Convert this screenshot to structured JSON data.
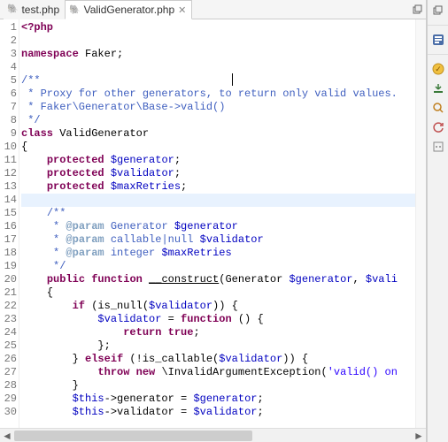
{
  "tabs": [
    {
      "label": "test.php",
      "active": false
    },
    {
      "label": "ValidGenerator.php",
      "active": true
    }
  ],
  "toolbar_icons": [
    "restore-icon",
    "sep",
    "outline-icon",
    "sep",
    "tasks-icon",
    "download-icon",
    "search-icon",
    "refresh-icon",
    "bookmarks-icon"
  ],
  "code_lines": [
    {
      "n": 1,
      "html": "<span class='kw'>&lt;?php</span>"
    },
    {
      "n": 2,
      "html": ""
    },
    {
      "n": 3,
      "html": "<span class='kw'>namespace</span> Faker;"
    },
    {
      "n": 4,
      "html": ""
    },
    {
      "n": 5,
      "html": "<span class='doc'>/**</span>",
      "cursor": true
    },
    {
      "n": 6,
      "html": "<span class='doc'> * Proxy for other generators, to return only valid values.</span>"
    },
    {
      "n": 7,
      "html": "<span class='doc'> * Faker\\Generator\\Base-&gt;valid()</span>"
    },
    {
      "n": 8,
      "html": "<span class='doc'> */</span>"
    },
    {
      "n": 9,
      "html": "<span class='kw'>class</span> ValidGenerator"
    },
    {
      "n": 10,
      "html": "{"
    },
    {
      "n": 11,
      "html": "    <span class='kw'>protected</span> <span class='var'>$generator</span>;"
    },
    {
      "n": 12,
      "html": "    <span class='kw'>protected</span> <span class='var'>$validator</span>;"
    },
    {
      "n": 13,
      "html": "    <span class='kw'>protected</span> <span class='var'>$maxRetries</span>;"
    },
    {
      "n": 14,
      "html": "",
      "highlight": true
    },
    {
      "n": 15,
      "html": "    <span class='doc'>/**</span>"
    },
    {
      "n": 16,
      "html": "    <span class='doc'> * <span class='tag'>@param</span> Generator <span class='var'>$generator</span></span>"
    },
    {
      "n": 17,
      "html": "    <span class='doc'> * <span class='tag'>@param</span> callable|null <span class='var'>$validator</span></span>"
    },
    {
      "n": 18,
      "html": "    <span class='doc'> * <span class='tag'>@param</span> integer <span class='var'>$maxRetries</span></span>"
    },
    {
      "n": 19,
      "html": "    <span class='doc'> */</span>"
    },
    {
      "n": 20,
      "html": "    <span class='kw'>public</span> <span class='kw'>function</span> <span style='text-decoration:underline'>__construct</span>(Generator <span class='var'>$generator</span>, <span class='var'>$vali</span>"
    },
    {
      "n": 21,
      "html": "    {"
    },
    {
      "n": 22,
      "html": "        <span class='kw'>if</span> (is_null(<span class='var'>$validator</span>)) {"
    },
    {
      "n": 23,
      "html": "            <span class='var'>$validator</span> = <span class='kw'>function</span> () {"
    },
    {
      "n": 24,
      "html": "                <span class='kw'>return</span> <span class='kw'>true</span>;"
    },
    {
      "n": 25,
      "html": "            };"
    },
    {
      "n": 26,
      "html": "        } <span class='kw'>elseif</span> (!is_callable(<span class='var'>$validator</span>)) {"
    },
    {
      "n": 27,
      "html": "            <span class='kw'>throw</span> <span class='kw'>new</span> \\InvalidArgumentException(<span class='str'>'valid() on</span>"
    },
    {
      "n": 28,
      "html": "        }"
    },
    {
      "n": 29,
      "html": "        <span class='var'>$this</span>-&gt;generator = <span class='var'>$generator</span>;"
    },
    {
      "n": 30,
      "html": "        <span class='var'>$this</span>-&gt;validator = <span class='var'>$validator</span>;"
    }
  ],
  "scroll": {
    "left_arrow": "◄",
    "right_arrow": "►"
  }
}
